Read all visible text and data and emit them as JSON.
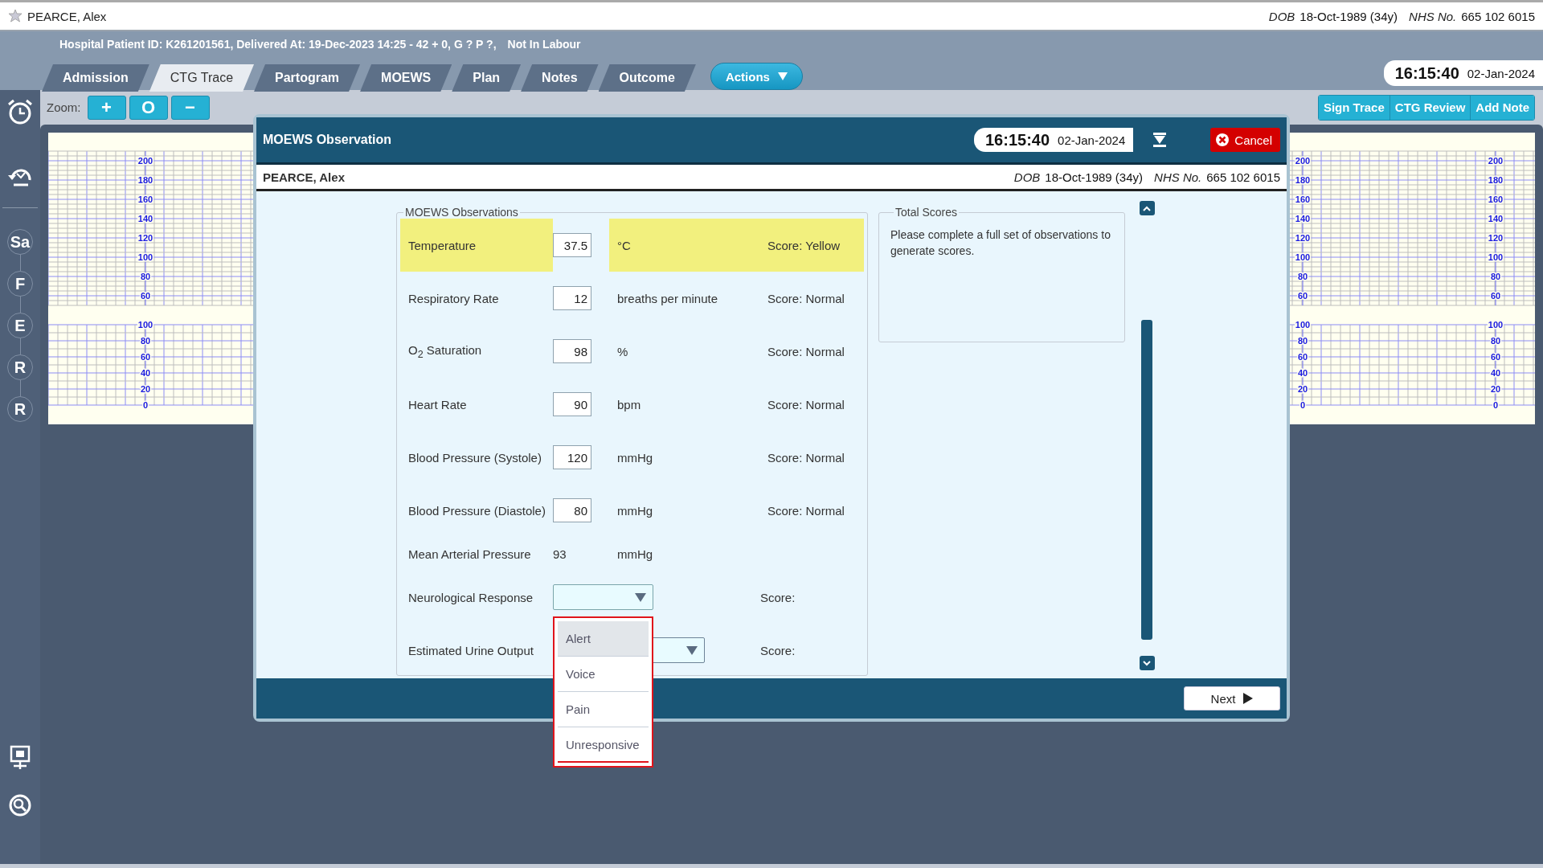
{
  "patient_bar": {
    "name": "PEARCE, Alex",
    "dob_label": "DOB",
    "dob": "18-Oct-1989 (34y)",
    "nhs_label": "NHS No.",
    "nhs": "665 102 6015"
  },
  "info_line": {
    "details": "Hospital Patient ID: K261201561, Delivered At: 19-Dec-2023 14:25 - 42 + 0, G ? P ?,",
    "status": "Not In Labour"
  },
  "tabs": [
    {
      "label": "Admission",
      "selected": false
    },
    {
      "label": "CTG Trace",
      "selected": true
    },
    {
      "label": "Partogram",
      "selected": false
    },
    {
      "label": "MOEWS",
      "selected": false
    },
    {
      "label": "Plan",
      "selected": false
    },
    {
      "label": "Notes",
      "selected": false
    },
    {
      "label": "Outcome",
      "selected": false
    }
  ],
  "actions_button": "Actions",
  "clock": {
    "time": "16:15:40",
    "date": "02-Jan-2024"
  },
  "zoom": {
    "label": "Zoom:",
    "buttons": [
      "+",
      "O",
      "−"
    ]
  },
  "trace_buttons": [
    "Sign Trace",
    "CTG Review",
    "Add Note"
  ],
  "sidebar": {
    "markers": [
      "Sa",
      "F",
      "E",
      "R",
      "R"
    ]
  },
  "trace_scales": [
    {
      "upper": [
        "200",
        "180",
        "160",
        "140",
        "120",
        "100",
        "80",
        "60"
      ],
      "lower": [
        "100",
        "80",
        "60",
        "40",
        "20",
        "0"
      ]
    },
    {
      "upper": [
        "200",
        "180",
        "160",
        "140",
        "120",
        "100",
        "80",
        "60"
      ],
      "lower": [
        "100",
        "80",
        "60",
        "40",
        "20",
        "0"
      ]
    },
    {
      "upper": [
        "200",
        "180",
        "160",
        "140",
        "120",
        "100",
        "80",
        "60"
      ],
      "lower": [
        "100",
        "80",
        "60",
        "40",
        "20",
        "0"
      ]
    }
  ],
  "modal": {
    "title": "MOEWS Observation",
    "clock": {
      "time": "16:15:40",
      "date": "02-Jan-2024"
    },
    "cancel_button": "Cancel",
    "patient": {
      "name": "PEARCE, Alex",
      "dob_label": "DOB",
      "dob": "18-Oct-1989 (34y)",
      "nhs_label": "NHS No.",
      "nhs": "665 102 6015"
    },
    "observations": {
      "legend": "MOEWS Observations",
      "rows": [
        {
          "kind": "input",
          "label": "Temperature",
          "value": "37.5",
          "unit": "°C",
          "score": "Score: Yellow",
          "highlighted": true
        },
        {
          "kind": "input",
          "label": "Respiratory Rate",
          "value": "12",
          "unit": "breaths per minute",
          "score": "Score: Normal",
          "highlighted": false
        },
        {
          "kind": "input",
          "label": "O$_{2}$ Saturation",
          "value": "98",
          "unit": "%",
          "score": "Score: Normal",
          "highlighted": false
        },
        {
          "kind": "input",
          "label": "Heart Rate",
          "value": "90",
          "unit": "bpm",
          "score": "Score: Normal",
          "highlighted": false
        },
        {
          "kind": "input",
          "label": "Blood Pressure (Systole)",
          "value": "120",
          "unit": "mmHg",
          "score": "Score: Normal",
          "highlighted": false
        },
        {
          "kind": "input",
          "label": "Blood Pressure (Diastole)",
          "value": "80",
          "unit": "mmHg",
          "score": "Score: Normal",
          "highlighted": false
        },
        {
          "kind": "readout",
          "label": "Mean Arterial Pressure",
          "value": "93",
          "unit": "mmHg"
        },
        {
          "kind": "select",
          "label": "Neurological Response",
          "score": "Score:",
          "expanded": true,
          "options": [
            {
              "label": "Alert",
              "selected": true
            },
            {
              "label": "Voice",
              "selected": false
            },
            {
              "label": "Pain",
              "selected": false
            },
            {
              "label": "Unresponsive",
              "selected": false
            }
          ]
        },
        {
          "kind": "select",
          "label": "Estimated Urine Output",
          "score": "Score:",
          "expanded": false
        }
      ]
    },
    "total_scores": {
      "legend": "Total Scores",
      "message": "Please complete a full set of observations to generate scores."
    },
    "next_button": "Next"
  }
}
